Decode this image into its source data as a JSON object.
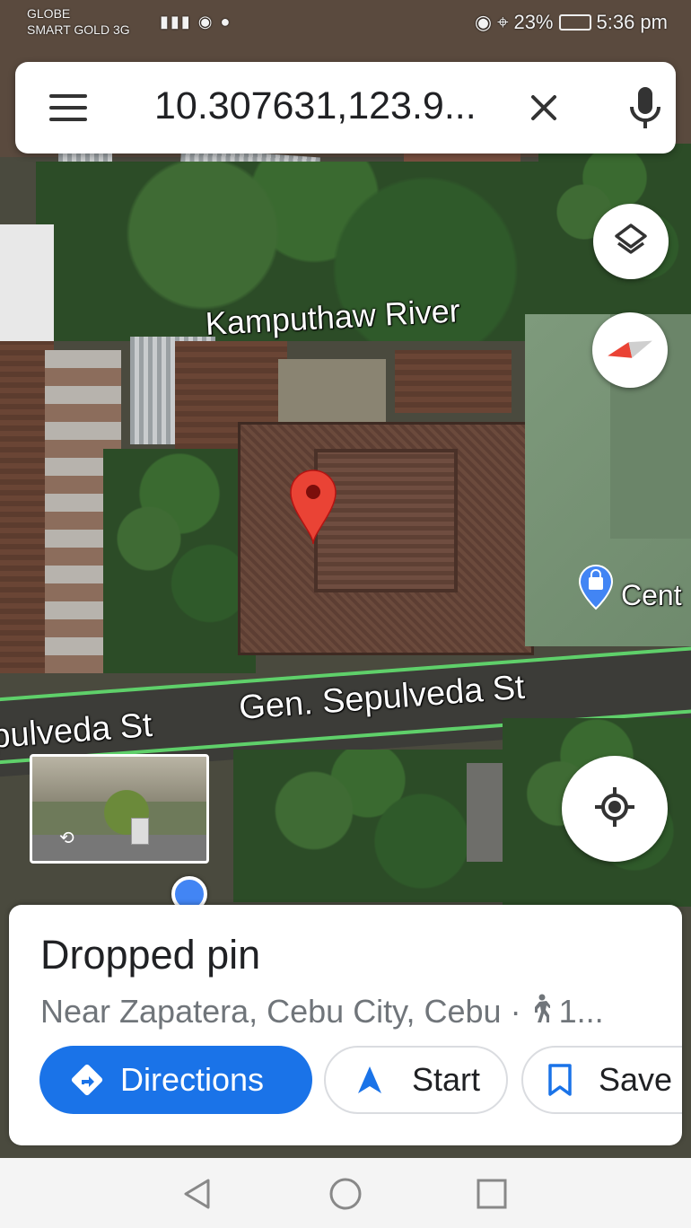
{
  "status_bar": {
    "carrier_line1": "GLOBE",
    "carrier_line2": "SMART GOLD 3G",
    "battery": "23%",
    "time": "5:36 pm"
  },
  "search": {
    "query": "10.307631,123.9..."
  },
  "map": {
    "labels": {
      "river": "Kamputhaw River",
      "street_main": "Gen. Sepulveda St",
      "street_left": "pulveda St",
      "place_partial": "Cent"
    }
  },
  "place": {
    "title": "Dropped pin",
    "subtitle": "Near Zapatera, Cebu City, Cebu · ",
    "walk_time": "1..."
  },
  "actions": {
    "directions": "Directions",
    "start": "Start",
    "save": "Save"
  },
  "colors": {
    "accent": "#1a73e8",
    "pin": "#ea4335",
    "road_line": "#5fd06a"
  },
  "icons": {
    "menu": "hamburger-icon",
    "clear": "close-icon",
    "mic": "mic-icon",
    "layers": "layers-icon",
    "compass": "compass-icon",
    "location": "my-location-icon",
    "pin": "map-pin-icon",
    "directions": "directions-icon",
    "start": "navigation-arrow-icon",
    "save": "bookmark-icon",
    "walk": "walking-icon",
    "back": "back-triangle-icon",
    "home": "home-circle-icon",
    "recents": "recents-square-icon"
  }
}
